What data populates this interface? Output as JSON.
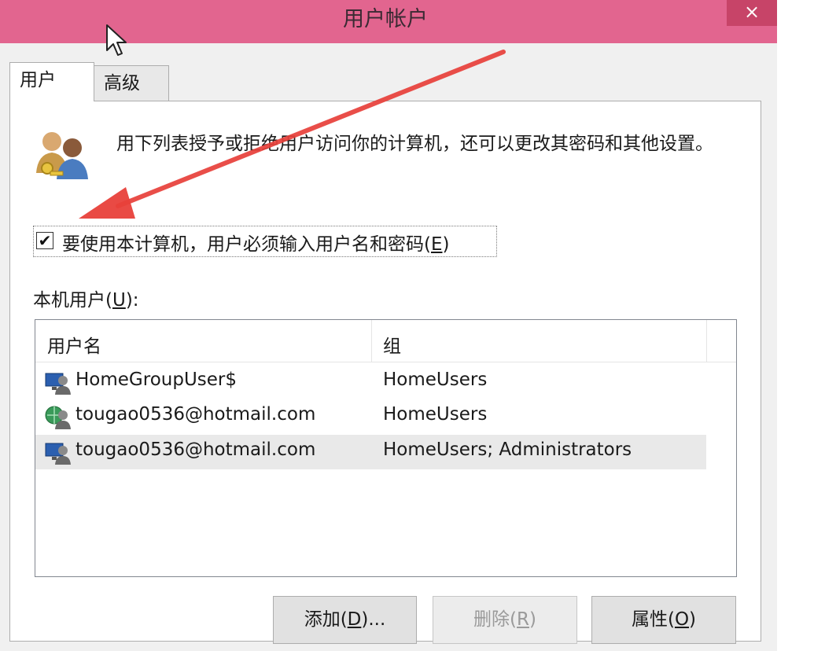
{
  "window": {
    "title": "用户帐户",
    "close_label": "×"
  },
  "tabs": [
    {
      "label": "用户",
      "active": true
    },
    {
      "label": "高级",
      "active": false
    }
  ],
  "description": "用下列表授予或拒绝用户访问你的计算机，还可以更改其密码和其他设置。",
  "require_password": {
    "label_text": "要使用本计算机，用户必须输入用户名和密码(",
    "accelerator": "E",
    "label_suffix": ")",
    "checked": true,
    "check_glyph": "✔"
  },
  "local_users": {
    "label_text": "本机用户(",
    "accelerator": "U",
    "label_suffix": "):"
  },
  "table": {
    "columns": [
      "用户名",
      "组"
    ],
    "rows": [
      {
        "name": "HomeGroupUser$",
        "group": "HomeUsers",
        "icon": "user-monitor-icon",
        "selected": false
      },
      {
        "name": "tougao0536@hotmail.com",
        "group": "HomeUsers",
        "icon": "user-globe-icon",
        "selected": false
      },
      {
        "name": "tougao0536@hotmail.com",
        "group": "HomeUsers; Administrators",
        "icon": "user-monitor-icon",
        "selected": true
      }
    ]
  },
  "buttons": {
    "add": {
      "text": "添加(",
      "accel": "D",
      "suffix": ")..."
    },
    "delete": {
      "text": "删除(",
      "accel": "R",
      "suffix": ")",
      "enabled": false
    },
    "properties": {
      "text": "属性(",
      "accel": "O",
      "suffix": ")"
    }
  },
  "colors": {
    "titlebar": "#e2658f",
    "close_button": "#c74468",
    "annotation_arrow": "#e8403a"
  }
}
